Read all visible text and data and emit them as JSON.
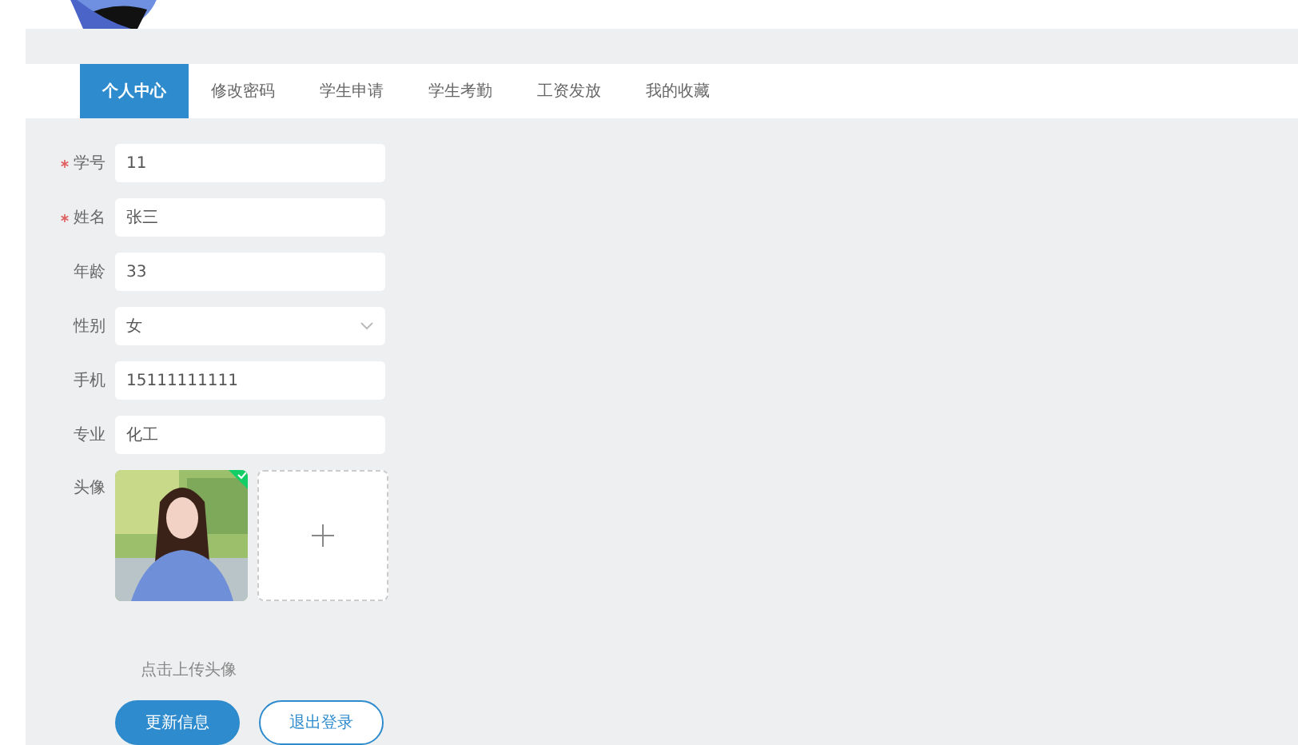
{
  "tabs": [
    {
      "label": "个人中心",
      "selected": true
    },
    {
      "label": "修改密码",
      "selected": false
    },
    {
      "label": "学生申请",
      "selected": false
    },
    {
      "label": "学生考勤",
      "selected": false
    },
    {
      "label": "工资发放",
      "selected": false
    },
    {
      "label": "我的收藏",
      "selected": false
    }
  ],
  "form": {
    "fields": [
      {
        "label": "学号",
        "required": true,
        "kind": "input",
        "value": "11"
      },
      {
        "label": "姓名",
        "required": true,
        "kind": "input",
        "value": "张三"
      },
      {
        "label": "年龄",
        "required": false,
        "kind": "input",
        "value": "33"
      },
      {
        "label": "性别",
        "required": false,
        "kind": "select",
        "value": "女"
      },
      {
        "label": "手机",
        "required": false,
        "kind": "input",
        "value": "15111111111"
      },
      {
        "label": "专业",
        "required": false,
        "kind": "input",
        "value": "化工"
      }
    ],
    "avatar": {
      "label": "头像",
      "uploaded": true,
      "hint": "点击上传头像"
    },
    "buttons": [
      {
        "label": "更新信息",
        "kind": "primary"
      },
      {
        "label": "退出登录",
        "kind": "outline"
      }
    ]
  }
}
